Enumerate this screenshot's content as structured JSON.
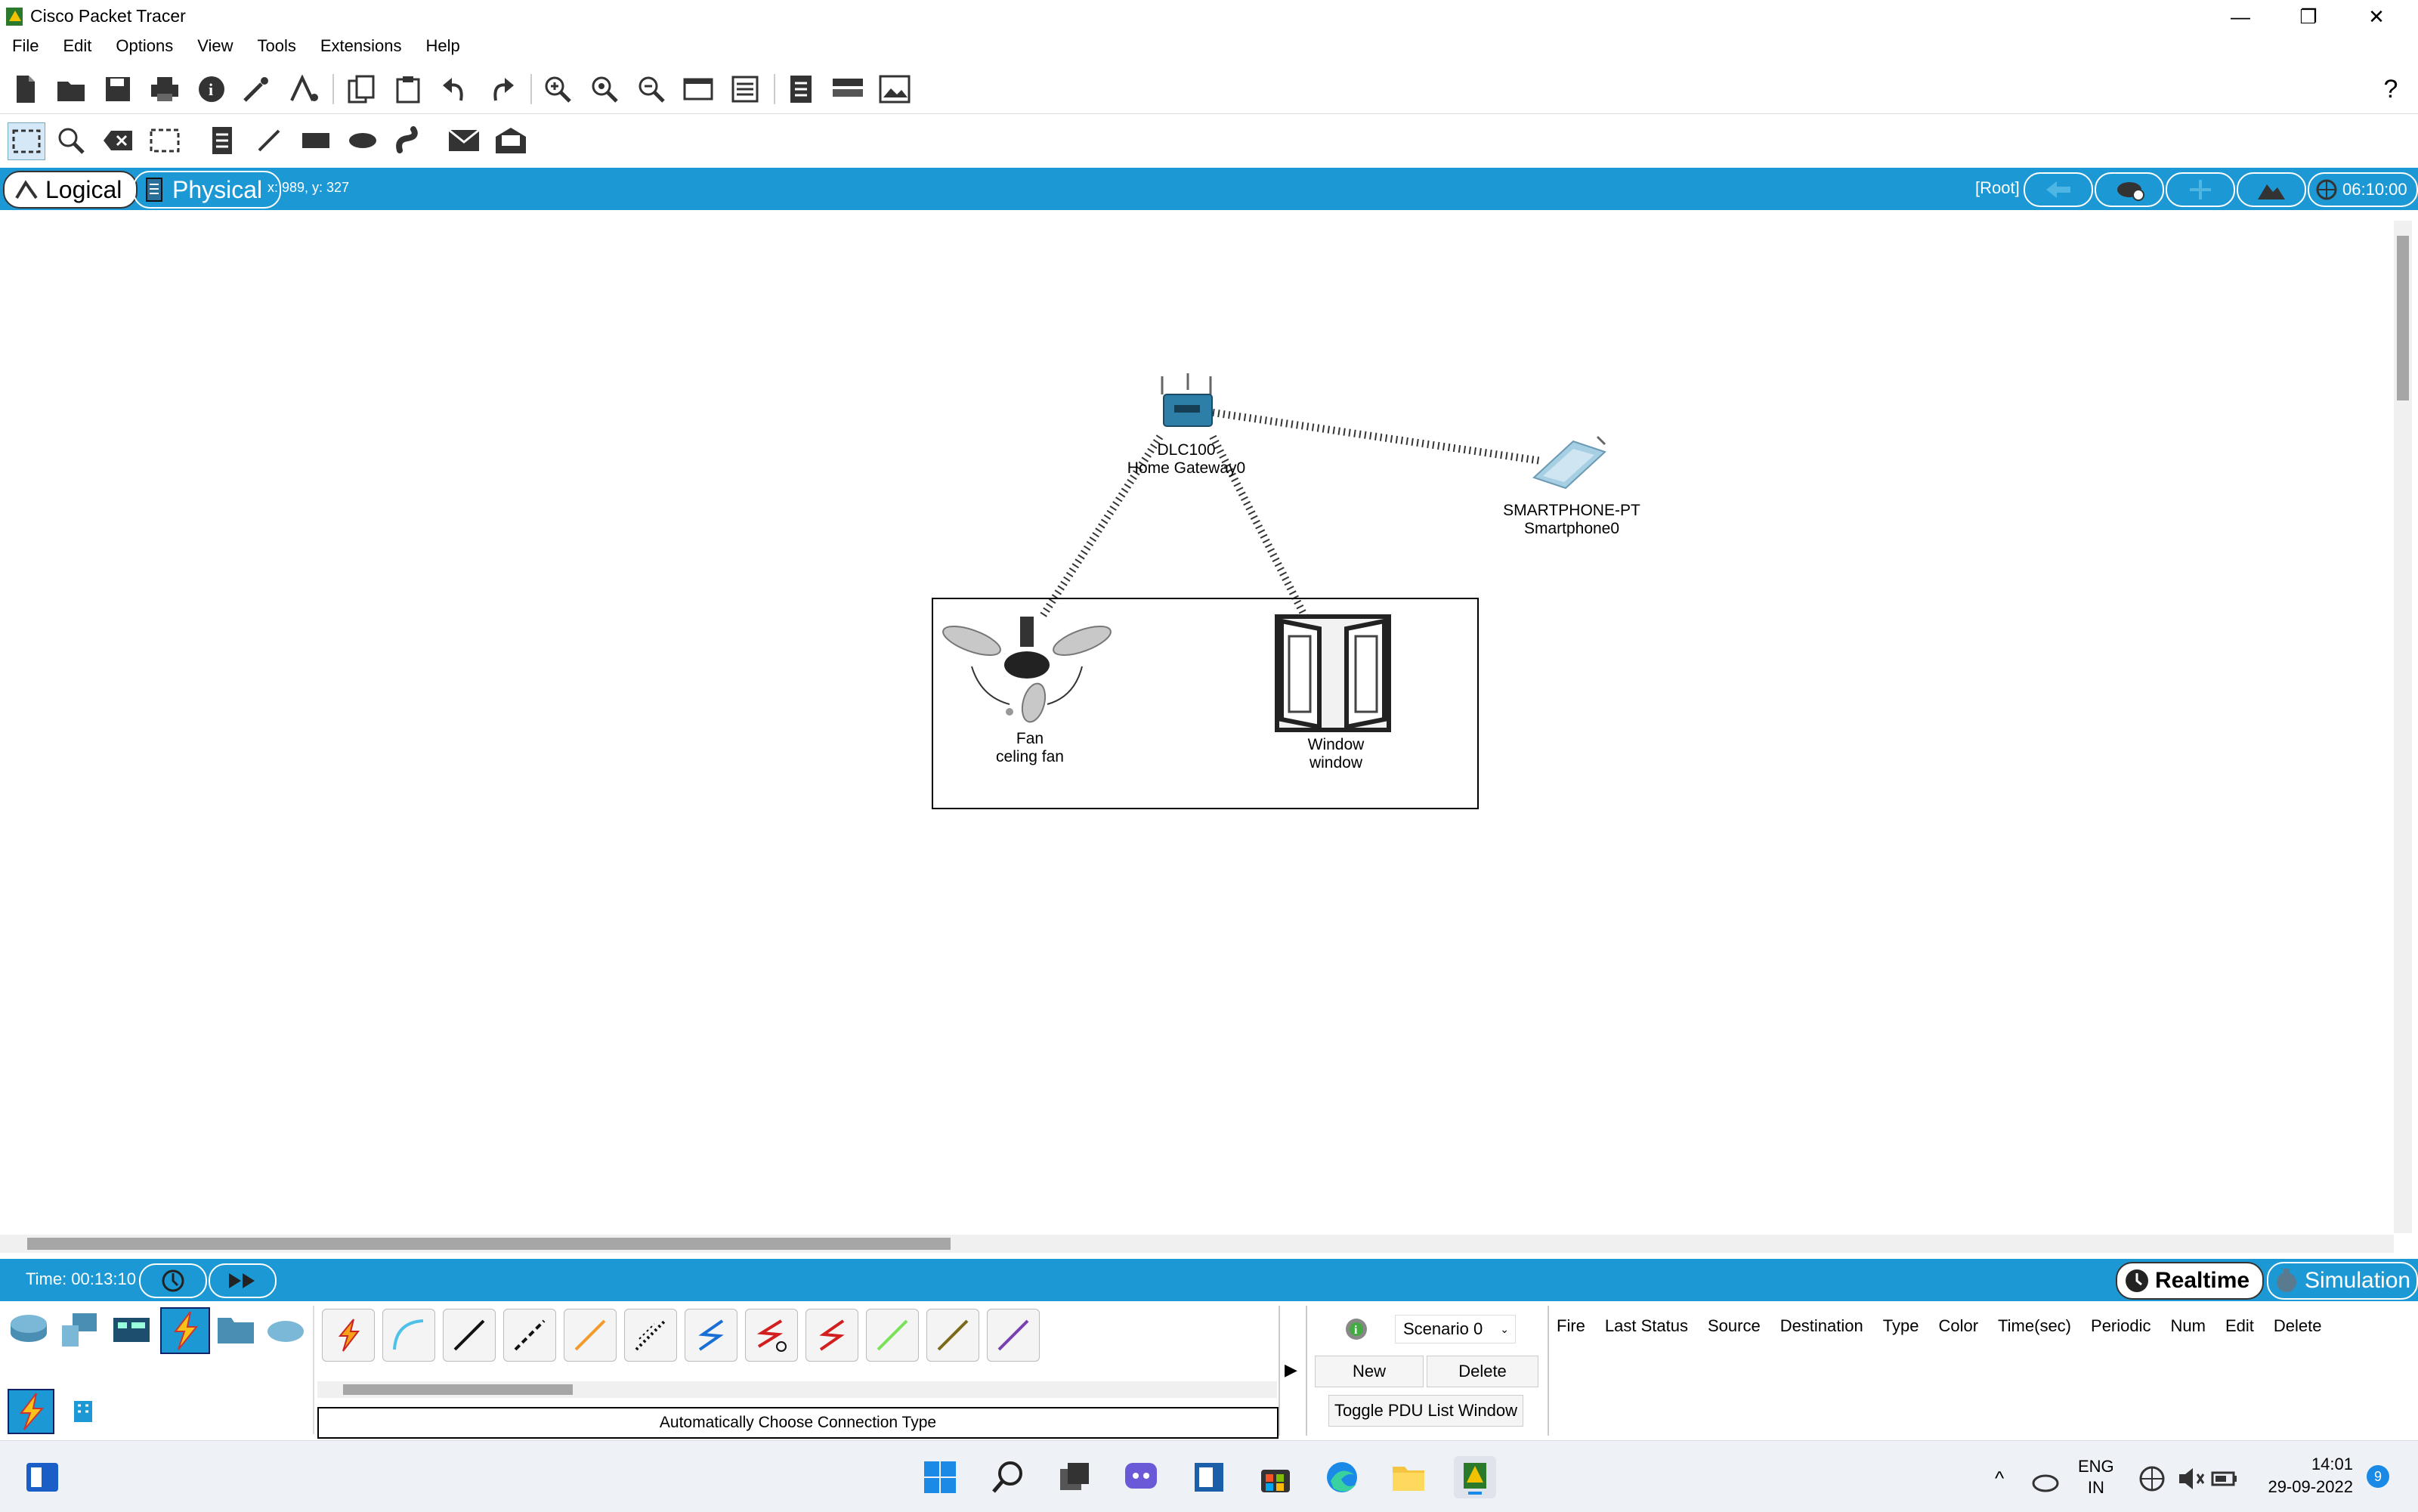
{
  "window": {
    "title": "Cisco Packet Tracer",
    "minimize": "—",
    "maximize": "❐",
    "close": "✕"
  },
  "menu": [
    "File",
    "Edit",
    "Options",
    "View",
    "Tools",
    "Extensions",
    "Help"
  ],
  "toolbar1": {
    "icons": [
      "new-file-icon",
      "open-folder-icon",
      "save-icon",
      "print-icon",
      "info-icon",
      "wizard-icon",
      "network-info-icon",
      "copy-icon",
      "paste-icon",
      "undo-icon",
      "redo-icon",
      "zoom-in-icon",
      "zoom-reset-icon",
      "zoom-out-icon",
      "drawing-palette-icon",
      "custom-device-icon",
      "notes-icon",
      "device-list-icon",
      "screenshot-icon"
    ],
    "help": "?"
  },
  "toolbar2": {
    "icons": [
      "select-icon",
      "inspect-icon",
      "delete-icon",
      "resize-icon",
      "note-icon",
      "line-icon",
      "rectangle-icon",
      "ellipse-icon",
      "freeform-icon",
      "simple-pdu-icon",
      "complex-pdu-icon"
    ]
  },
  "viewbar": {
    "logical": "Logical",
    "physical": "Physical",
    "coords": "x: 989, y: 327",
    "root": "[Root]",
    "clock": "06:10:00"
  },
  "devices": {
    "gateway": {
      "line1": "DLC100",
      "line2": "Home Gateway0"
    },
    "smartphone": {
      "line1": "SMARTPHONE-PT",
      "line2": "Smartphone0"
    },
    "fan": {
      "line1": "Fan",
      "line2": "celing fan"
    },
    "window": {
      "line1": "Window",
      "line2": "window"
    }
  },
  "timebar": {
    "time": "Time: 00:13:10",
    "realtime": "Realtime",
    "simulation": "Simulation"
  },
  "bottom": {
    "connection_label": "Automatically Choose Connection Type",
    "scenario": "Scenario 0",
    "new": "New",
    "delete": "Delete",
    "toggle": "Toggle PDU List Window",
    "pdu_columns": [
      "Fire",
      "Last Status",
      "Source",
      "Destination",
      "Type",
      "Color",
      "Time(sec)",
      "Periodic",
      "Num",
      "Edit",
      "Delete"
    ]
  },
  "colors": {
    "accent": "#1c99d4"
  },
  "taskbar": {
    "lang1": "ENG",
    "lang2": "IN",
    "time": "14:01",
    "date": "29-09-2022",
    "badge": "9"
  }
}
